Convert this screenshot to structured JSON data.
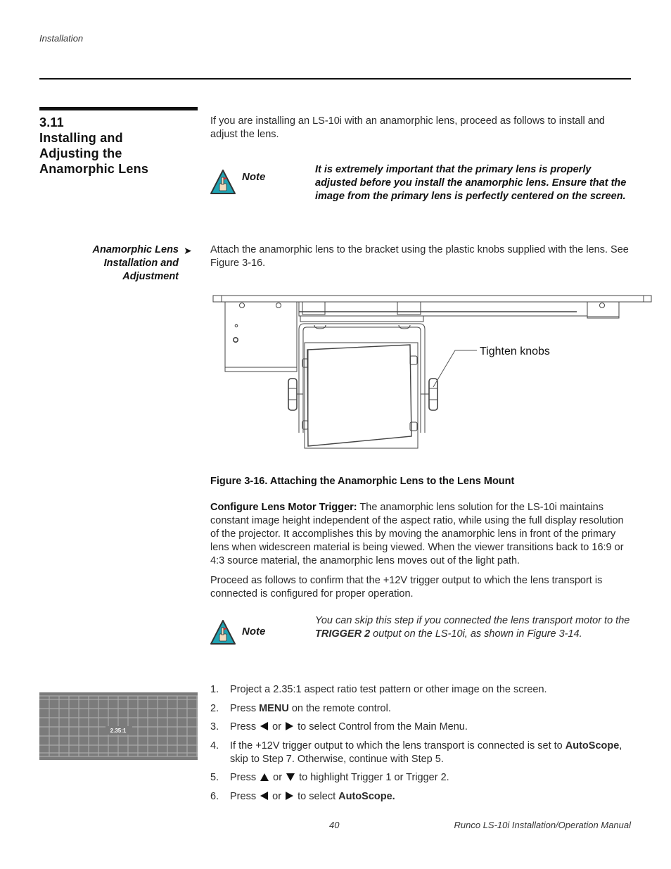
{
  "header": {
    "running_head": "Installation"
  },
  "section": {
    "number": "3.11",
    "title_lines": [
      "Installing and",
      "Adjusting the",
      "Anamorphic Lens"
    ]
  },
  "intro": "If you are installing an LS-10i with an anamorphic lens, proceed as follows to install and adjust the lens.",
  "note1": {
    "icon": "note-hand-warning-icon",
    "label": "Note",
    "text": "It is extremely important that the primary lens is properly adjusted before you install the anamorphic lens. Ensure that the image from the primary lens is perfectly centered on the screen."
  },
  "subsection": {
    "heading_lines": [
      "Anamorphic Lens",
      "Installation and",
      "Adjustment"
    ],
    "arrow": "➤",
    "text": "Attach the anamorphic lens to the bracket using the plastic knobs supplied with the lens. See Figure 3-16."
  },
  "figure": {
    "callout": "Tighten knobs",
    "caption": "Figure 3-16. Attaching the Anamorphic Lens to the Lens Mount"
  },
  "configure": {
    "lead": "Configure Lens Motor Trigger:",
    "text": " The anamorphic lens solution for the LS-10i maintains constant image height independent of the aspect ratio, while using the full display resolution of the projector. It accomplishes this by moving the anamorphic lens in front of the primary lens when widescreen material is being viewed. When the viewer transitions back to 16:9 or 4:3 source material, the anamorphic lens moves out of the light path."
  },
  "proceed": "Proceed as follows to confirm that the +12V trigger output to which the lens transport is connected is configured for proper operation.",
  "note2": {
    "icon": "note-hand-warning-icon",
    "label": "Note",
    "text_before": "You can skip this step if you connected the lens transport motor to the ",
    "bold": "TRIGGER 2",
    "text_after": " output on the LS-10i, as shown in Figure 3-14."
  },
  "test_pattern": {
    "label": "2.35:1",
    "background": "#7b7b7b",
    "grid_color": "#a9a9a9"
  },
  "steps": [
    {
      "num": "1.",
      "text": "Project a 2.35:1 aspect ratio test pattern or other image on the screen."
    },
    {
      "num": "2.",
      "pre": "Press ",
      "bold": "MENU",
      "post": " on the remote control."
    },
    {
      "num": "3.",
      "pre": "Press",
      "mid": "or",
      "post": "to select Control from the Main Menu."
    },
    {
      "num": "4.",
      "pre": "If the +12V trigger output to which the lens transport is connected is set to ",
      "bold": "AutoScope",
      "post": ", skip to Step 7. Otherwise, continue with Step 5."
    },
    {
      "num": "5.",
      "pre": "Press",
      "mid": "or",
      "post": "to highlight Trigger 1 or Trigger 2."
    },
    {
      "num": "6.",
      "pre": "Press",
      "mid": "or",
      "post": "to select ",
      "bold": "AutoScope."
    }
  ],
  "footer": {
    "page_number": "40",
    "manual_title": "Runco LS-10i Installation/Operation Manual"
  },
  "colors": {
    "note_icon_fill": "#1fa3b3",
    "note_icon_border": "#333333",
    "rule": "#111111"
  }
}
